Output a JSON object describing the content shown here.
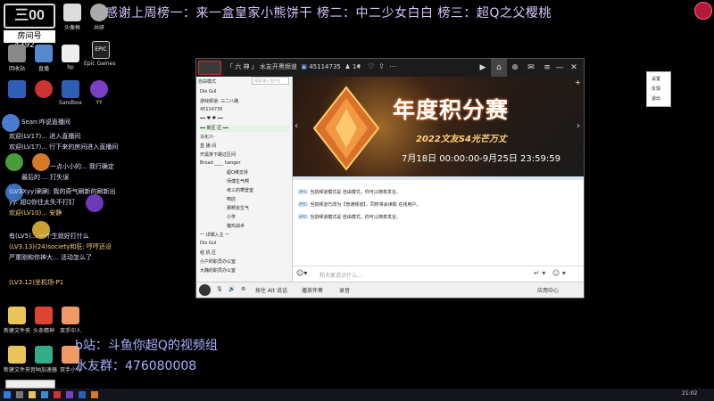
{
  "banner": {
    "text": "感谢上周榜一：来一盒皇家小熊饼干 榜二：中二少女白白 榜三：超Q之父樱桃"
  },
  "logo": {
    "mark": "三00",
    "sub": "房间号",
    "number": "4392"
  },
  "desktop_icons": [
    {
      "label": "此电脑",
      "color": "#4a90d9"
    },
    {
      "label": "头像框",
      "color": "#ddd"
    },
    {
      "label": "共研",
      "color": "#aaa"
    },
    {
      "label": "回收站",
      "color": "#888"
    },
    {
      "label": "直播",
      "color": "#5588cc"
    },
    {
      "label": "bp",
      "color": "#eee"
    },
    {
      "label": "Epic Games Launcher",
      "color": "#222"
    },
    {
      "label": "Sandbox",
      "color": "#2f5fb4"
    },
    {
      "label": "YY",
      "color": "#7b3fc4"
    },
    {
      "label": "新建文件夹",
      "color": "#e8c45a"
    },
    {
      "label": "头条精神",
      "color": "#d43"
    },
    {
      "label": "双手中人",
      "color": "#e96"
    },
    {
      "label": "新建文件夹 (2)",
      "color": "#e8c45a"
    },
    {
      "label": "音呐加速器",
      "color": "#3a8"
    },
    {
      "label": "双手小号",
      "color": "#e96"
    }
  ],
  "chat_overlay": [
    {
      "text": "Sean:咋说直播间",
      "color": "#e0e0ff"
    },
    {
      "text": "欢迎(LV17)... 进入直播间",
      "color": "#e0e0ff"
    },
    {
      "text": "欢迎(LV17)... 行下来的房间进入直播间",
      "color": "#e0e0ff"
    },
    {
      "text": "一点小小的... 我行确定",
      "color": "#e0e0ff"
    },
    {
      "text": "最后的 ... 打失误",
      "color": "#e0e0ff"
    },
    {
      "text": "(LV3Xyy)刷刷: 我的奇气刷新的刷新出",
      "color": "#e0e0ff"
    },
    {
      "text": "yy: 超Q你往太失不打钉",
      "color": "#e0e0ff"
    },
    {
      "text": "欢迎(LV10)... 安静",
      "color": "#ffd27a"
    },
    {
      "text": "有(LV5)... 一个生就好打什么",
      "color": "#e0e0ff"
    },
    {
      "text": "(LV3.13)(24)society和狂: 哼哼还没",
      "color": "#ffd27a"
    },
    {
      "text": "严重刚和你神大... 活动怎么了",
      "color": "#e0e0ff"
    },
    {
      "text": "(LV3.12)坐机场-P1",
      "color": "#ffd27a"
    }
  ],
  "app": {
    "title": "「 六 神 」 水友开黑频道",
    "channel_id": "45114735",
    "online": "14",
    "panel_label": "自由模式",
    "search_placeholder": "搜索/输入用户名",
    "tree": [
      "Dio Gul",
      "游戏频道: 三二八路",
      "45114735",
      "━━ ♥ ♥ ━━",
      "━━ 新区 区 ━━",
      "马化六·",
      "直 播 间",
      "开黑排下路过区间",
      "Broad ____ hanger",
      "超Q维支持",
      "师傅生气啊",
      "考三的攀登室",
      "鸭店",
      "那啊去生气",
      "小学",
      "猪鸡战术",
      "一 详细入主 一",
      "Dio Gul",
      "组 机 区",
      "小户的职员办公室",
      "大魏的职员办公室"
    ],
    "banner_title": "年度积分赛",
    "banner_sub": "2022文友S4光芒万丈",
    "banner_date": "7月18日 00:00:00-9月25日 23:59:59",
    "notices": [
      {
        "tag": "通知:",
        "text": "当前频道模式是 自由模式，你可以随意发言。"
      },
      {
        "tag": "通知:",
        "text": "当前频道已改为【普通频道】，同时将会读取 在线用户。"
      },
      {
        "tag": "通知:",
        "text": "当前频道模式是 自由模式，你可以随意发言。"
      }
    ],
    "input_placeholder": "和大家说点什么...",
    "status_items": [
      "按住 Alt 说话",
      "播放伴奏",
      "录音",
      "应用中心"
    ],
    "popup": [
      "设置",
      "反馈",
      "退出"
    ]
  },
  "bottom": {
    "bili": "b站：斗鱼你超Q的视频组",
    "qq": "水友群：476080008"
  },
  "taskbar": {
    "time": "21:02"
  }
}
